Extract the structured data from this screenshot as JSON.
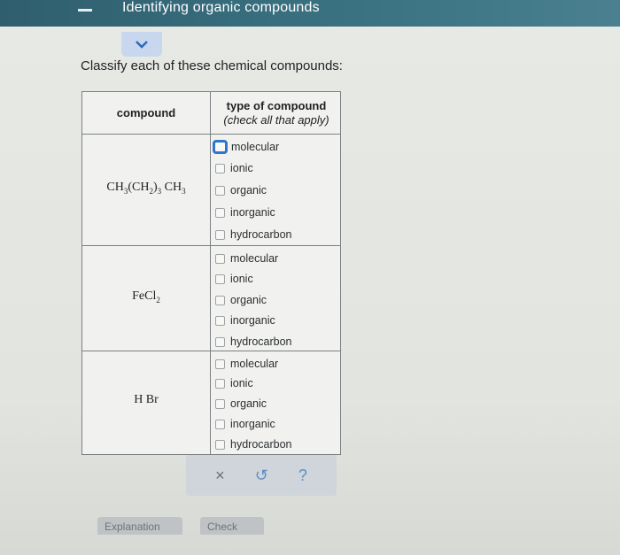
{
  "header": {
    "title": "Identifying organic compounds"
  },
  "instruction": "Classify each of these chemical compounds:",
  "table": {
    "col_compound": "compound",
    "col_type": "type of compound",
    "col_type_hint": "(check all that apply)",
    "rows": [
      {
        "formula_parts": [
          "CH",
          "3",
          "(CH",
          "2",
          ")",
          "3",
          "CH",
          "3"
        ],
        "options": [
          "molecular",
          "ionic",
          "organic",
          "inorganic",
          "hydrocarbon"
        ]
      },
      {
        "formula_parts": [
          "FeCl",
          "2"
        ],
        "options": [
          "molecular",
          "ionic",
          "organic",
          "inorganic",
          "hydrocarbon"
        ]
      },
      {
        "formula_parts": [
          "H Br"
        ],
        "options": [
          "molecular",
          "ionic",
          "organic",
          "inorganic",
          "hydrocarbon"
        ]
      }
    ]
  },
  "actions": {
    "clear": "×",
    "undo": "↺",
    "help": "?"
  },
  "bottom": {
    "left": "Explanation",
    "right": "Check"
  }
}
